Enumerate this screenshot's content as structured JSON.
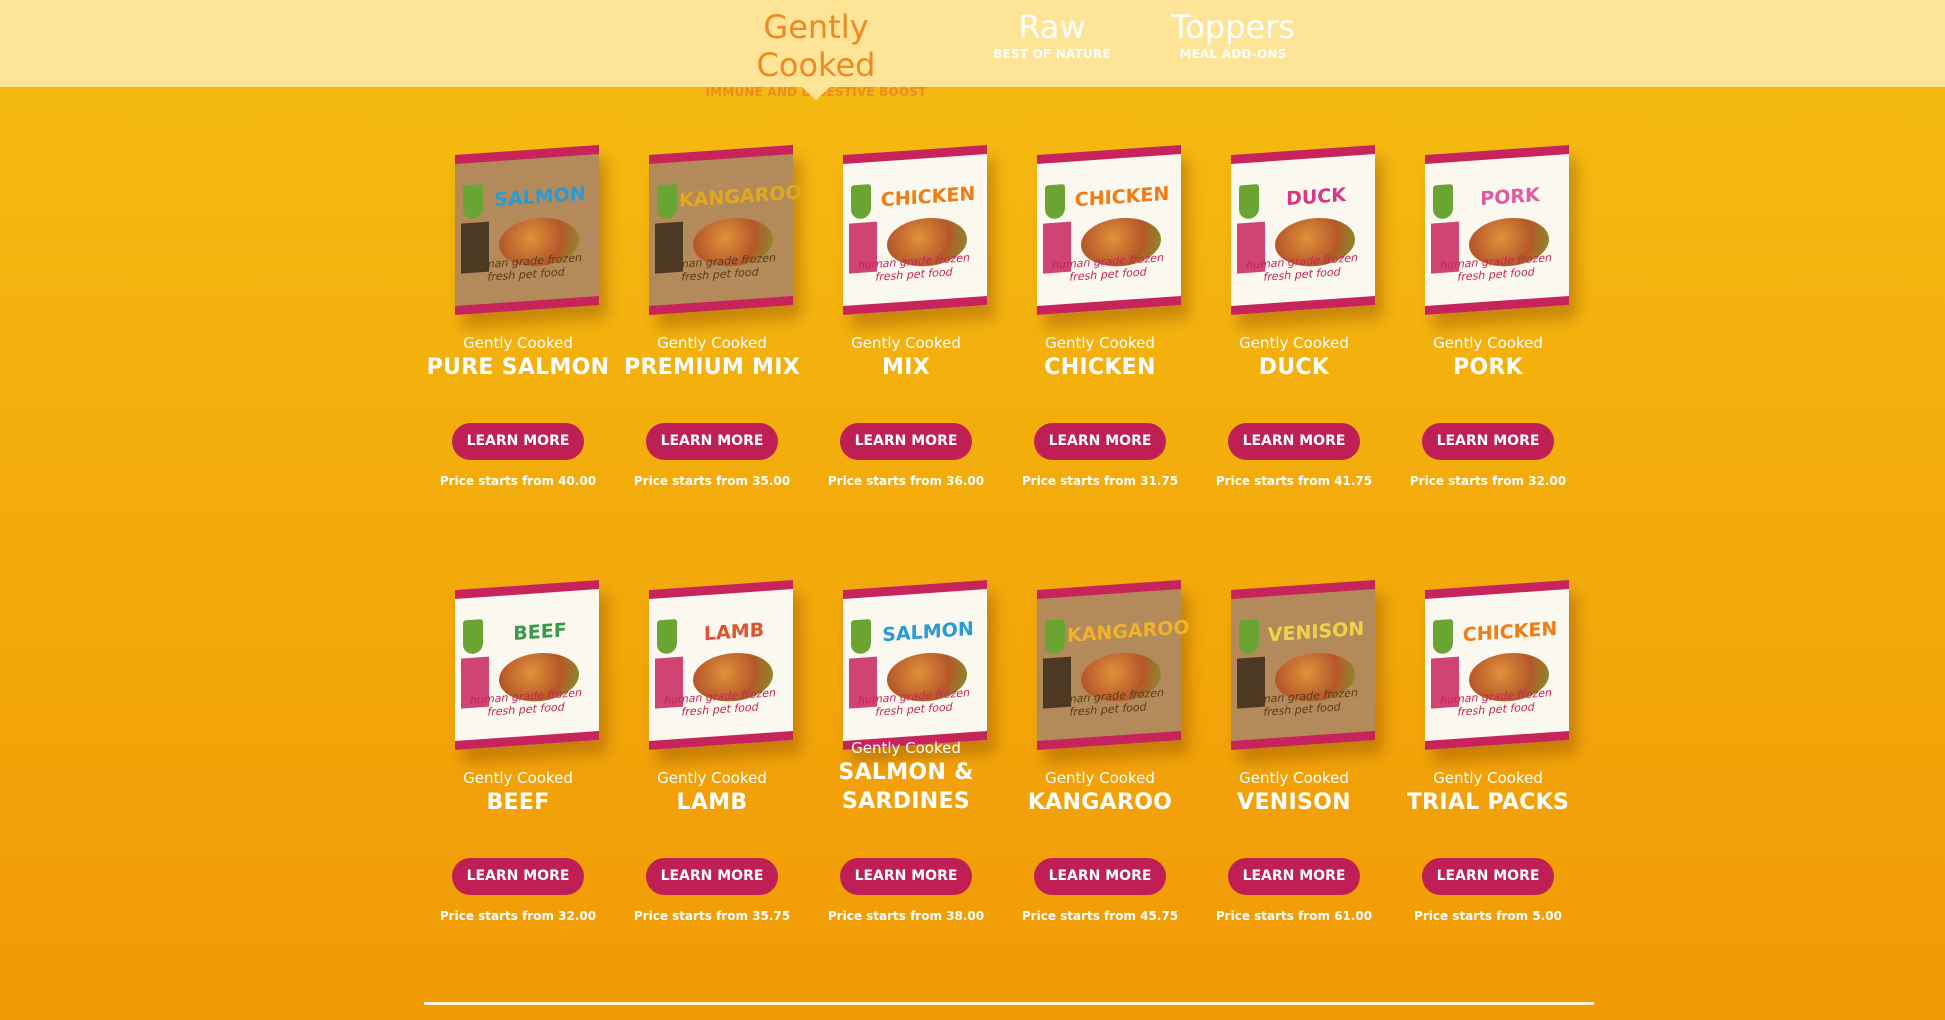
{
  "nav": {
    "tabs": [
      {
        "title": "Gently Cooked",
        "subtitle": "IMMUNE AND DIGESTIVE BOOST",
        "active": true
      },
      {
        "title": "Raw",
        "subtitle": "BEST OF NATURE",
        "active": false
      },
      {
        "title": "Toppers",
        "subtitle": "MEAL ADD-ONS",
        "active": false
      }
    ]
  },
  "products": [
    {
      "sub": "Gently Cooked",
      "title": "PURE SALMON",
      "button": "LEARN MORE",
      "price": "Price starts from 40.00",
      "pack": "SALMON",
      "style": "kraft",
      "color": "#2a9ad6"
    },
    {
      "sub": "Gently Cooked",
      "title": "PREMIUM MIX",
      "button": "LEARN MORE",
      "price": "Price starts from 35.00",
      "pack": "KANGAROO",
      "style": "kraft",
      "color": "#e0a91e"
    },
    {
      "sub": "Gently Cooked",
      "title": "MIX",
      "button": "LEARN MORE",
      "price": "Price starts from 36.00",
      "pack": "CHICKEN",
      "style": "white",
      "color": "#ef7d16"
    },
    {
      "sub": "Gently Cooked",
      "title": "CHICKEN",
      "button": "LEARN MORE",
      "price": "Price starts from 31.75",
      "pack": "CHICKEN",
      "style": "white",
      "color": "#ef7d16"
    },
    {
      "sub": "Gently Cooked",
      "title": "DUCK",
      "button": "LEARN MORE",
      "price": "Price starts from 41.75",
      "pack": "DUCK",
      "style": "white",
      "color": "#d63a85"
    },
    {
      "sub": "Gently Cooked",
      "title": "PORK",
      "button": "LEARN MORE",
      "price": "Price starts from 32.00",
      "pack": "PORK",
      "style": "white",
      "color": "#e05aa3"
    },
    {
      "sub": "Gently Cooked",
      "title": "BEEF",
      "button": "LEARN MORE",
      "price": "Price starts from 32.00",
      "pack": "BEEF",
      "style": "white",
      "color": "#3a9a48"
    },
    {
      "sub": "Gently Cooked",
      "title": "LAMB",
      "button": "LEARN MORE",
      "price": "Price starts from 35.75",
      "pack": "LAMB",
      "style": "white",
      "color": "#e0522f"
    },
    {
      "sub": "Gently Cooked",
      "title": "SALMON & SARDINES",
      "button": "LEARN MORE",
      "price": "Price starts from 38.00",
      "pack": "SALMON",
      "style": "white",
      "color": "#2a9ad6"
    },
    {
      "sub": "Gently Cooked",
      "title": "KANGAROO",
      "button": "LEARN MORE",
      "price": "Price starts from 45.75",
      "pack": "KANGAROO",
      "style": "kraft",
      "color": "#f0b32a"
    },
    {
      "sub": "Gently Cooked",
      "title": "VENISON",
      "button": "LEARN MORE",
      "price": "Price starts from 61.00",
      "pack": "VENISON",
      "style": "kraft",
      "color": "#f0d24a"
    },
    {
      "sub": "Gently Cooked",
      "title": "TRIAL PACKS",
      "button": "LEARN MORE",
      "price": "Price starts from 5.00",
      "pack": "CHICKEN",
      "style": "white",
      "color": "#ef7d16"
    }
  ],
  "pack_tagline": "human grade frozen fresh pet food"
}
